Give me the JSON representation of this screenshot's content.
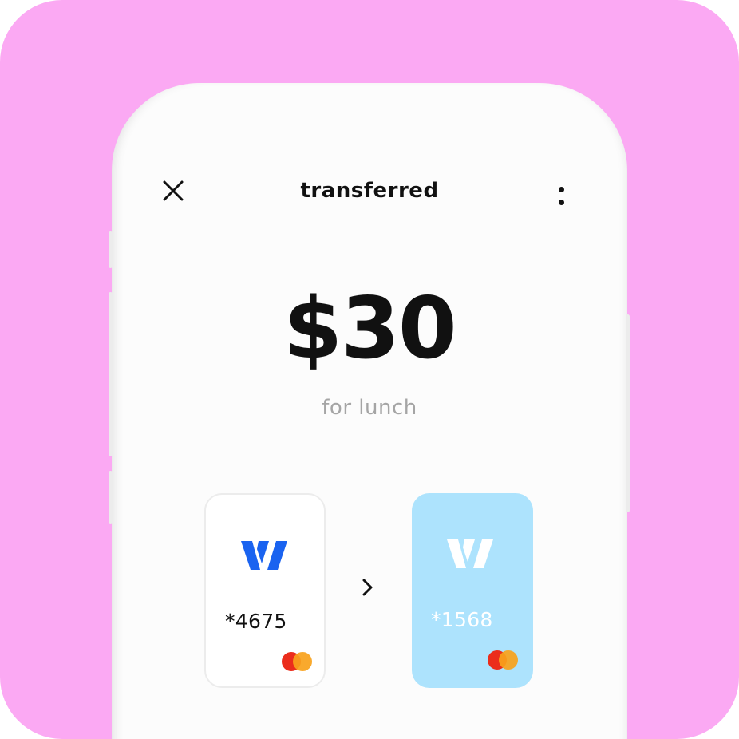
{
  "header": {
    "title": "transferred",
    "close_icon": "close-icon",
    "more_icon": "more-vertical-icon"
  },
  "transfer": {
    "amount": "$30",
    "note": "for lunch"
  },
  "cards": {
    "from": {
      "number": "*4675",
      "logo_icon": "w-logo-icon",
      "network_icon": "mastercard-icon"
    },
    "to": {
      "number": "*1568",
      "logo_icon": "w-logo-icon",
      "network_icon": "mastercard-icon"
    },
    "arrow_icon": "chevron-right-icon"
  },
  "colors": {
    "background": "#fba9f3",
    "accent": "#1a63f0",
    "to_card": "#ade3fd",
    "note_text": "#a5a5a5"
  }
}
